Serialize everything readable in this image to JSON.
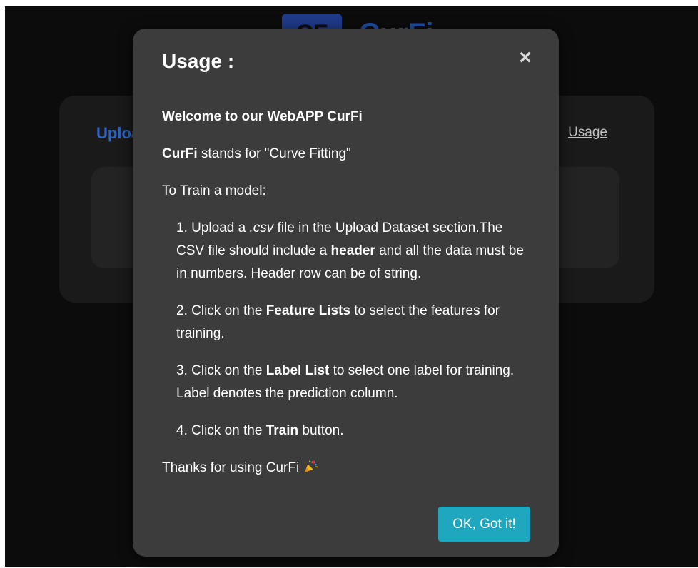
{
  "background": {
    "brand_logo_text": "CF",
    "brand_name": "CurFi",
    "card_title": "Upload Dataset",
    "usage_link": "Usage"
  },
  "modal": {
    "title": "Usage :",
    "close_icon": "×",
    "welcome_prefix": "Welcome to our WebAPP ",
    "welcome_app": "CurFi",
    "tagline_app": "CurFi",
    "tagline_rest": " stands for \"Curve Fitting\"",
    "train_intro": "To Train a model:",
    "steps": [
      {
        "num": "1.",
        "a": "Upload a ",
        "em": ".csv",
        "b": " file in the Upload Dataset section.The CSV file should include a ",
        "strong": "header",
        "c": " and all the data must be in numbers. Header row can be of string."
      },
      {
        "num": "2.",
        "a": "Click on the ",
        "strong": "Feature Lists",
        "b": " to select the features for training."
      },
      {
        "num": "3.",
        "a": "Click on the ",
        "strong": "Label List",
        "b": " to select one label for training. Label denotes the prediction column."
      },
      {
        "num": "4.",
        "a": "Click on the ",
        "strong": "Train",
        "b": " button."
      }
    ],
    "thanks": "Thanks for using CurFi",
    "thanks_icon": "party-popper-icon",
    "ok_button": "OK, Got it!"
  },
  "colors": {
    "app_background": "#0c0c0c",
    "modal_background": "#3c3c3d",
    "ok_button": "#1ea7bf",
    "brand_blue": "#1f4fa3"
  }
}
